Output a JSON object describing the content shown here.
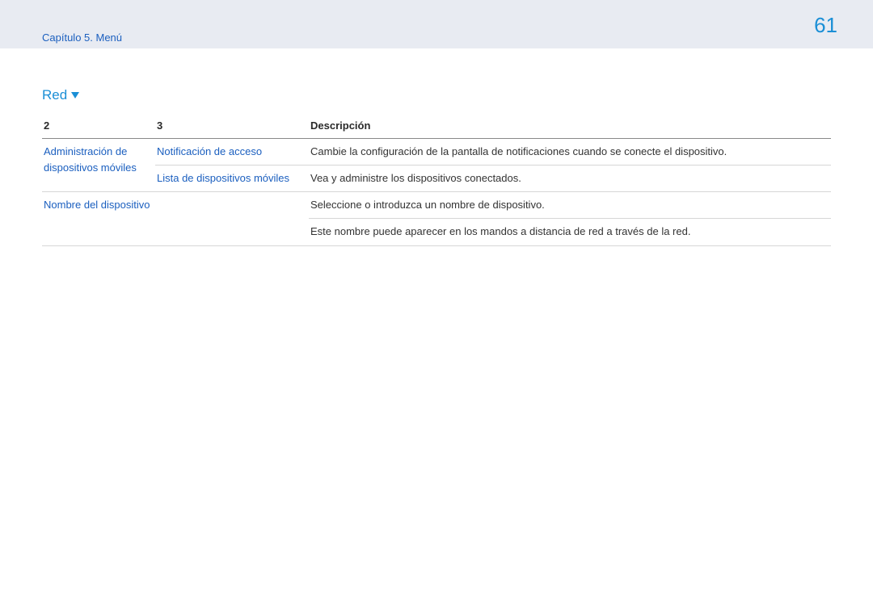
{
  "header": {
    "breadcrumb": "Capítulo 5. Menú",
    "page_number": "61"
  },
  "section": {
    "title": "Red"
  },
  "table": {
    "headers": {
      "col2": "2",
      "col3": "3",
      "desc": "Descripción"
    },
    "rows": {
      "r1": {
        "c2": "Administración de dispositivos móviles",
        "c3": "Notificación de acceso",
        "desc": "Cambie la configuración de la pantalla de notificaciones cuando se conecte el dispositivo."
      },
      "r2": {
        "c3": "Lista de dispositivos móviles",
        "desc": "Vea y administre los dispositivos conectados."
      },
      "r3": {
        "c2": "Nombre del dispositivo",
        "desc_line1": "Seleccione o introduzca un nombre de dispositivo.",
        "desc_line2": "Este nombre puede aparecer en los mandos a distancia de red a través de la red."
      }
    }
  }
}
